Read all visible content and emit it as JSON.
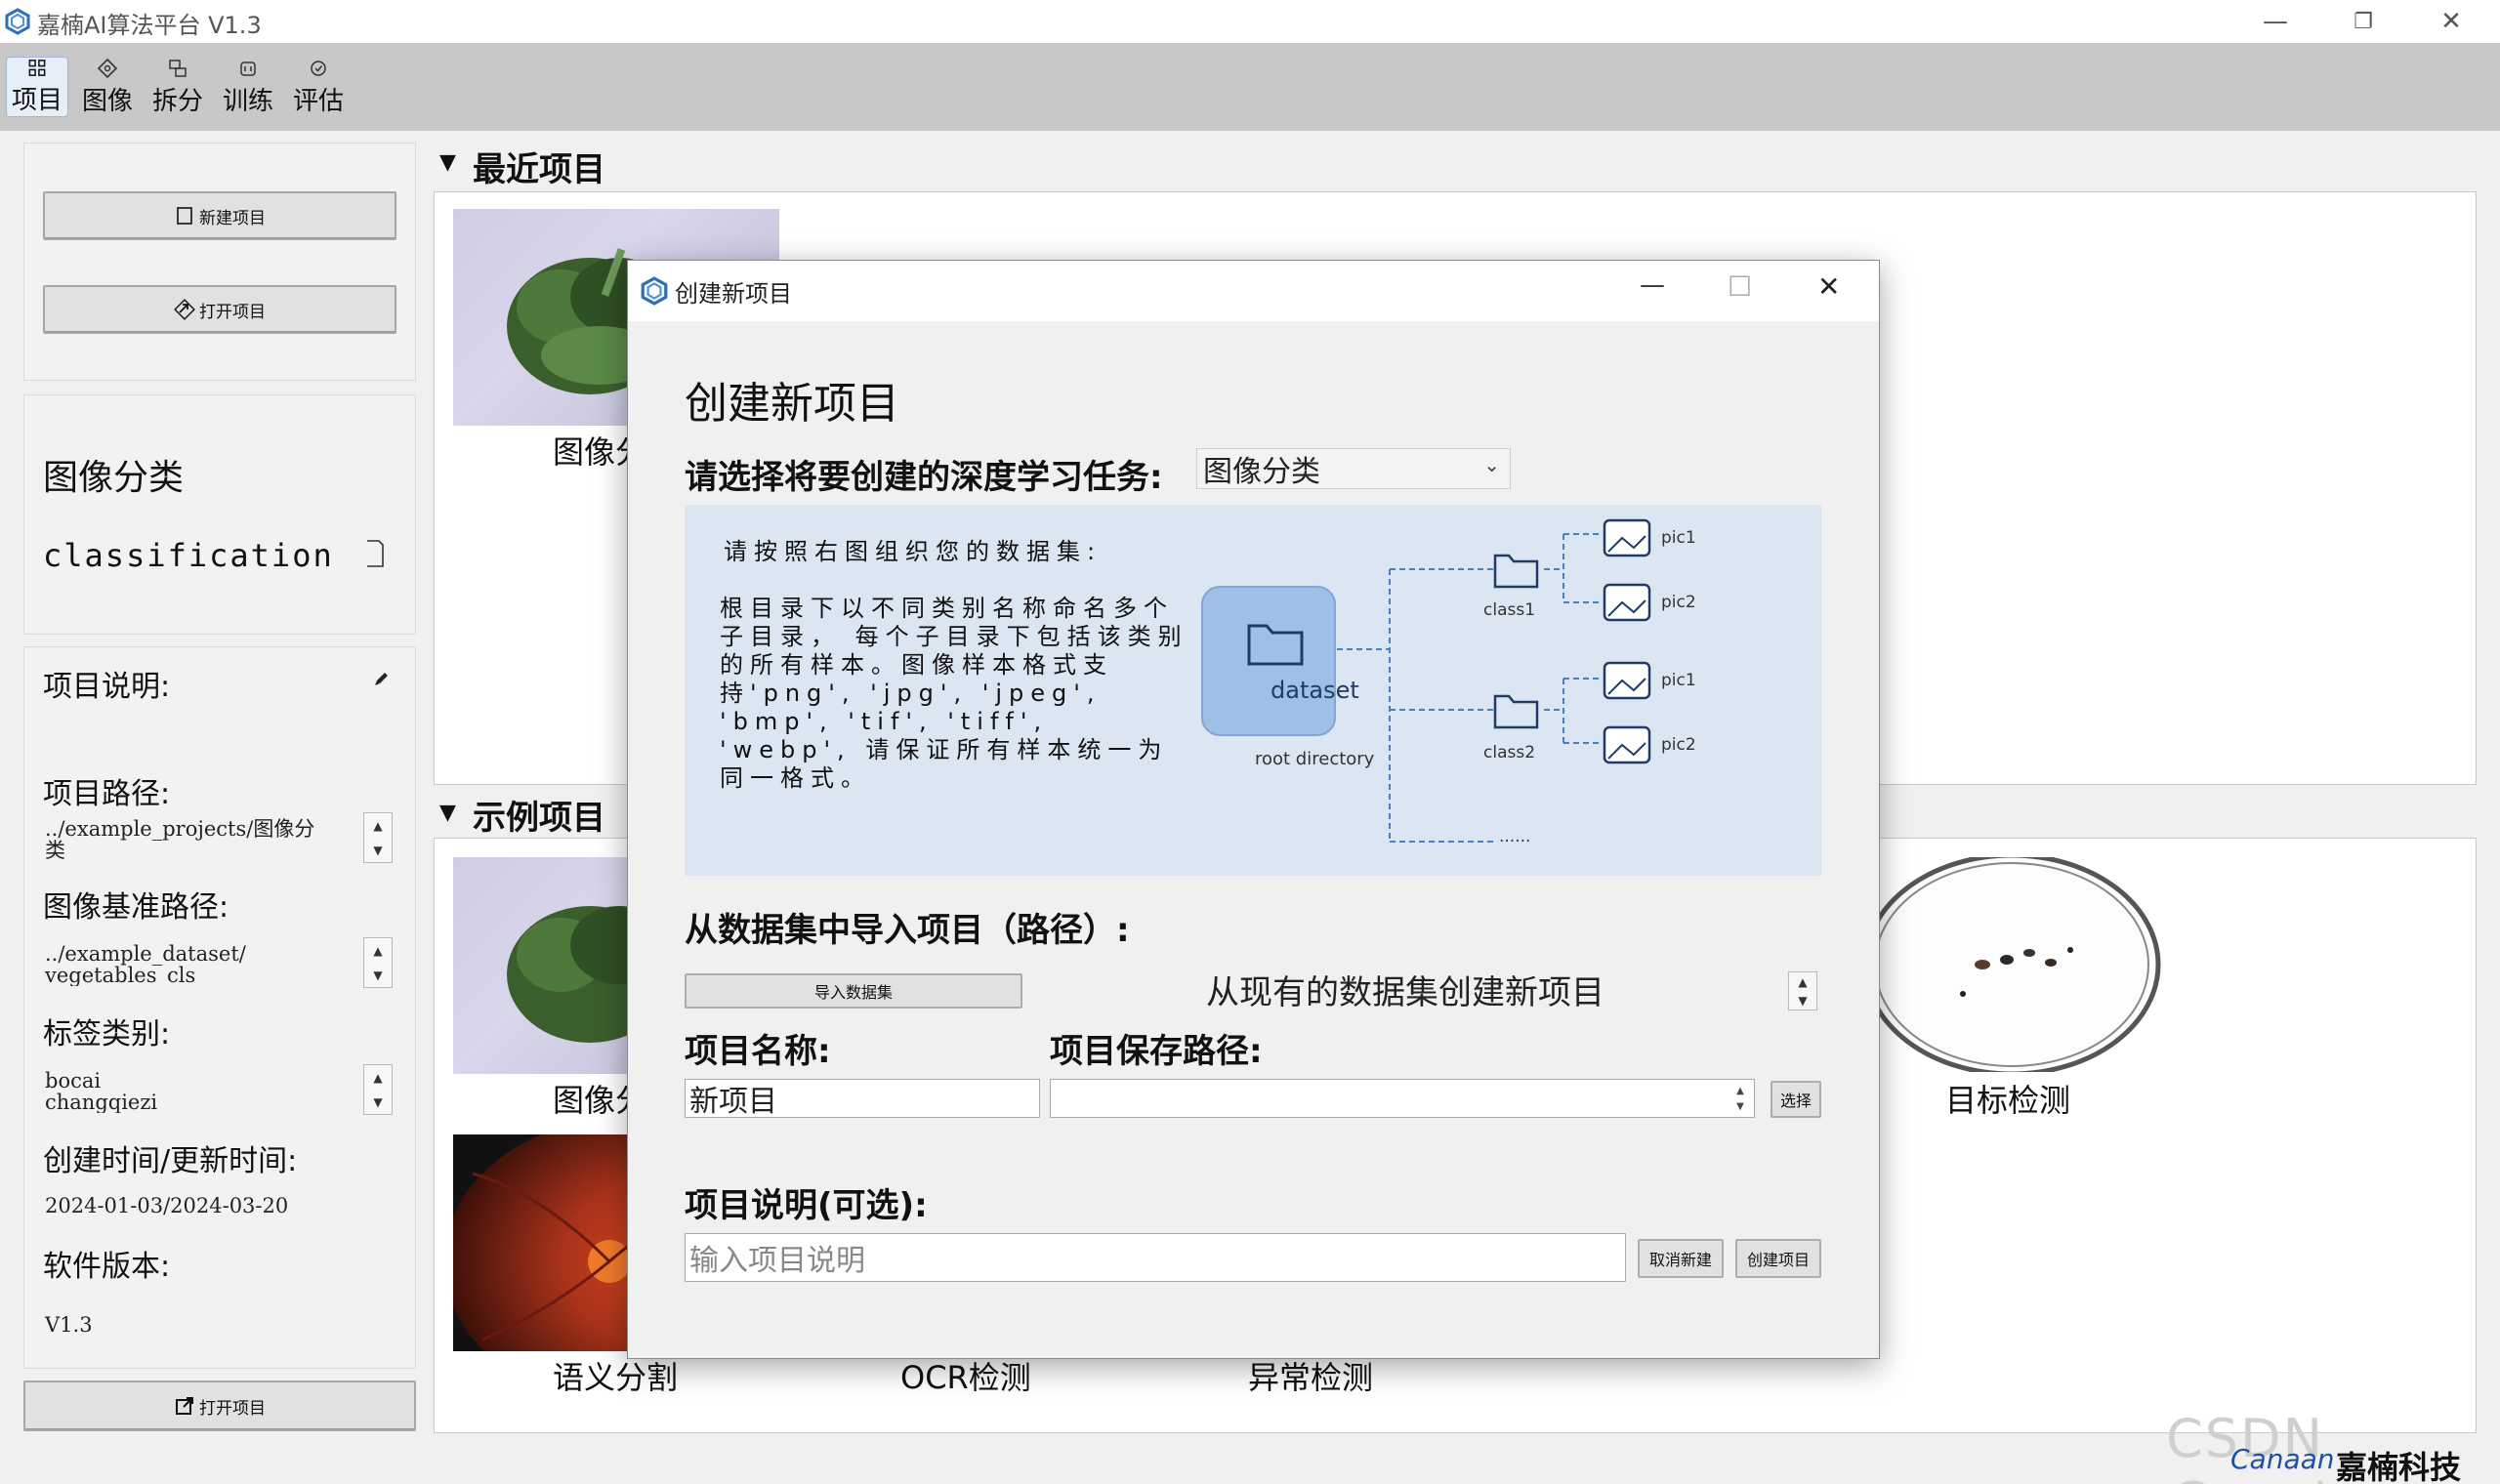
{
  "window": {
    "title": "嘉楠AI算法平台 V1.3",
    "controls": {
      "minimize": "—",
      "restore": "❐",
      "close": "✕"
    }
  },
  "toolbar": {
    "items": [
      {
        "label": "项目",
        "icon": "grid-icon",
        "active": true
      },
      {
        "label": "图像",
        "icon": "image-tag-icon"
      },
      {
        "label": "拆分",
        "icon": "split-icon"
      },
      {
        "label": "训练",
        "icon": "train-icon"
      },
      {
        "label": "评估",
        "icon": "evaluate-icon"
      }
    ]
  },
  "left": {
    "new_project": "新建项目",
    "open_project": "打开项目",
    "task_cn": "图像分类",
    "task_en": "classification",
    "desc_label": "项目说明:",
    "path_label": "项目路径:",
    "path_value": "../example_projects/图像分\n类",
    "base_label": "图像基准路径:",
    "base_value": "../example_dataset/\nvegetables_cls",
    "tags_label": "标签类别:",
    "tags_value": "bocai\nchangqiezi",
    "time_label": "创建时间/更新时间:",
    "time_value": "2024-01-03/2024-03-20",
    "version_label": "软件版本:",
    "version_value": "V1.3",
    "bottom_open": "打开项目"
  },
  "recent": {
    "title": "最近项目",
    "items": [
      {
        "label": "图像分类"
      }
    ]
  },
  "examples": {
    "title": "示例项目",
    "items": [
      {
        "label": "图像分类"
      },
      {
        "label": "目标检测"
      },
      {
        "label": "语义分割"
      },
      {
        "label": "OCR检测"
      },
      {
        "label": "异常检测"
      }
    ]
  },
  "dialog": {
    "title": "创建新项目",
    "heading": "创建新项目",
    "task_prompt": "请选择将要创建的深度学习任务:",
    "task_value": "图像分类",
    "diagram": {
      "intro": "请按照右图组织您的数据集:",
      "body": "根目录下以不同类别名称命名多个子目录， 每个子目录下包括该类别的所有样本。图像样本格式支持'png', 'jpg', 'jpeg', 'bmp', 'tif', 'tiff', 'webp', 请保证所有样本统一为同一格式。",
      "root_label": "dataset",
      "root_caption": "root directory",
      "class1": "class1",
      "class2": "class2",
      "ellipsis": "......",
      "pic1": "pic1",
      "pic2": "pic2"
    },
    "import_title": "从数据集中导入项目（路径）:",
    "import_button": "导入数据集",
    "import_status": "从现有的数据集创建新项目",
    "name_label": "项目名称:",
    "name_value": "新项目",
    "save_label": "项目保存路径:",
    "save_value": "",
    "choose_button": "选择",
    "desc_label": "项目说明(可选):",
    "desc_placeholder": "输入项目说明",
    "cancel_button": "取消新建",
    "create_button": "创建项目",
    "controls": {
      "minimize": "—",
      "maximize": "☐",
      "close": "✕"
    }
  },
  "branding": {
    "watermark": "CSDN @sxztzm",
    "logo_en": "Canaan",
    "logo_cn": "嘉楠科技"
  },
  "colors": {
    "accent": "#2e6fb5",
    "diagram_bg": "#dbe6f2",
    "toolbar_bg": "#c8c8c8"
  }
}
